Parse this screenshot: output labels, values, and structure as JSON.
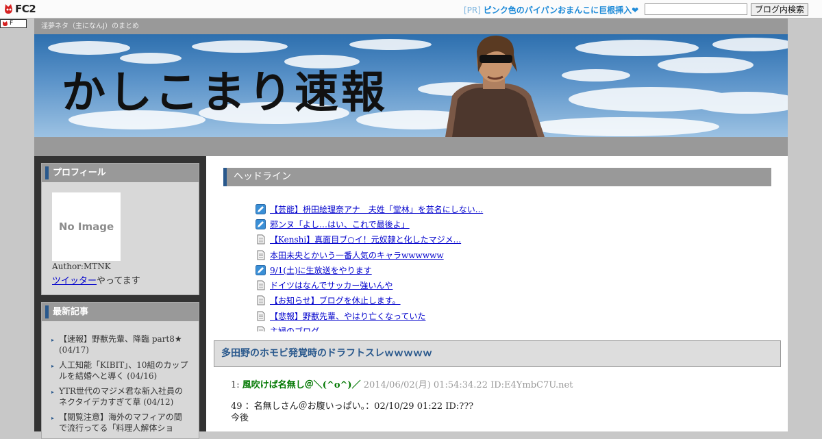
{
  "fc2bar": {
    "logo_text": "FC2",
    "pr_tag": "[PR]",
    "pr_text": "ピンク色のパイパンおまんこに巨根挿入❤",
    "search_value": "",
    "search_button": "ブログ内検索"
  },
  "tag_label": "F",
  "blog": {
    "tagline": "淫夢ネタ（主になんJ）のまとめ",
    "title": "かしこまり速報"
  },
  "profile": {
    "title": "プロフィール",
    "no_image": "No Image",
    "author": "Author:MTNK",
    "twitter_link": "ツイッター",
    "twitter_suffix": "やってます"
  },
  "recent": {
    "title": "最新記事",
    "items": [
      "【速報】野獣先輩、降臨 part8★ (04/17)",
      "人工知能「KIBIT」、10組のカップルを結婚へと導く (04/16)",
      "YTR世代のマジメ君な新入社員のネクタイデカすぎて草 (04/12)",
      "【閲覧注意】海外のマフィアの間で流行ってる「料理人解体ショ"
    ]
  },
  "headline": {
    "title": "ヘッドライン",
    "items": [
      {
        "text": "【芸能】枡田絵理奈アナ　夫姓「堂林」を芸名にしない...",
        "icon": "blog-pen-icon"
      },
      {
        "text": "邪ンヌ「よし…はい、これで最後よ」",
        "icon": "blog-pen-icon"
      },
      {
        "text": "【Kenshi】真面目ブ○イ！元奴隷と化したマジメ...",
        "icon": "document-icon"
      },
      {
        "text": "本田未央とかいう一番人気のキャラwwwwww",
        "icon": "document-icon"
      },
      {
        "text": "9/1(土)に生放送をやります",
        "icon": "blog-pen-icon"
      },
      {
        "text": "ドイツはなんでサッカー強いんや",
        "icon": "document-icon"
      },
      {
        "text": "【お知らせ】ブログを休止します。",
        "icon": "document-icon"
      },
      {
        "text": "【悲報】野獣先輩、やはり亡くなっていた",
        "icon": "document-icon"
      },
      {
        "text": "主婦のブログ",
        "icon": "document-icon"
      }
    ]
  },
  "post": {
    "title": "多田野のホモビ発覚時のドラフトスレｗｗｗｗｗ",
    "number": "1:",
    "name": "風吹けば名無し＠＼(^o^)／",
    "date_id": "2014/06/02(月) 01:54:34.22 ID:E4YmbC7U.net",
    "body_line1": "49 ：名無しさん＠お腹いっぱい。：02/10/29 01:22 ID:???",
    "body_line2": "今後"
  },
  "colors": {
    "accent_blue": "#29588c",
    "link": "#0000cc",
    "name_green": "#007700"
  }
}
